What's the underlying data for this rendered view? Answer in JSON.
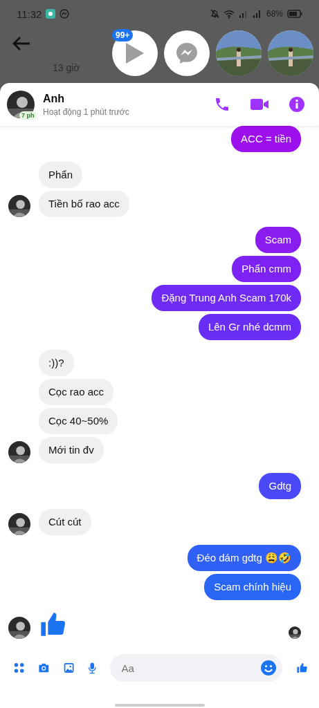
{
  "status_bar": {
    "time": "11:32",
    "battery": "68%"
  },
  "background": {
    "subtitle": "13 giờ"
  },
  "chat_heads": [
    {
      "kind": "video",
      "badge": "99+"
    },
    {
      "kind": "messenger"
    },
    {
      "kind": "picture"
    },
    {
      "kind": "picture"
    }
  ],
  "conversation": {
    "name": "Anh",
    "status": "Hoạt động 1 phút trước",
    "avatar_badge": "7 ph"
  },
  "groups": [
    {
      "kind": "sent",
      "messages": [
        {
          "text": "ACC = tiền",
          "color": "#9d10ec"
        }
      ]
    },
    {
      "kind": "received",
      "messages": [
        {
          "text": "Phẩn"
        },
        {
          "text": "Tiền bố rao acc"
        }
      ]
    },
    {
      "kind": "sent",
      "messages": [
        {
          "text": "Scam",
          "color": "#8a1cf0"
        },
        {
          "text": "Phẩn cmm",
          "color": "#7c22f2"
        },
        {
          "text": "Đặng Trung Anh Scam 170k",
          "color": "#6f2af5"
        },
        {
          "text": "Lên Gr nhé dcmm",
          "color": "#6a2df5"
        }
      ]
    },
    {
      "kind": "received",
      "messages": [
        {
          "text": ":))?"
        },
        {
          "text": "Cọc rao acc"
        },
        {
          "text": "Cọc 40~50%"
        },
        {
          "text": "Mới tin đv"
        }
      ]
    },
    {
      "kind": "sent",
      "messages": [
        {
          "text": "Gdtg",
          "color": "#4a49f7"
        }
      ]
    },
    {
      "kind": "received",
      "messages": [
        {
          "text": "Cút cút"
        }
      ]
    },
    {
      "kind": "sent",
      "messages": [
        {
          "text": "Đéo dám gdtg 😩🤣",
          "color": "#3060f5"
        },
        {
          "text": "Scam chính hiệu",
          "color": "#2a66f5"
        }
      ]
    },
    {
      "kind": "like",
      "seen": true
    }
  ],
  "composer": {
    "placeholder": "Aa"
  }
}
